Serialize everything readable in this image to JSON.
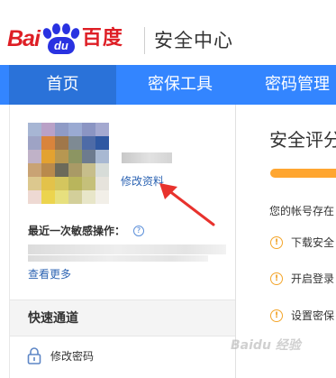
{
  "header": {
    "logo": {
      "text_left": "Bai",
      "paw_text": "du",
      "text_cn": "百度"
    },
    "title": "安全中心"
  },
  "nav": {
    "items": [
      {
        "label": "首页",
        "active": true
      },
      {
        "label": "密保工具",
        "active": false
      },
      {
        "label": "密码管理",
        "active": false
      }
    ]
  },
  "sidebar": {
    "edit_profile_link": "修改资料",
    "recent_sensitive_label": "最近一次敏感操作：",
    "help_icon_glyph": "?",
    "view_more_link": "查看更多",
    "quick_access_title": "快速通道",
    "quick_items": [
      {
        "label": "修改密码",
        "icon": "lock-icon"
      }
    ]
  },
  "main": {
    "title": "安全评分",
    "description": "您的帐号存在",
    "warnings": [
      {
        "text": "下载安全",
        "icon": "warning-circle-icon"
      },
      {
        "text": "开启登录",
        "icon": "warning-circle-icon"
      },
      {
        "text": "设置密保",
        "icon": "warning-circle-icon"
      }
    ],
    "warning_glyph": "!"
  },
  "colors": {
    "brand_red": "#de1e25",
    "brand_blue": "#2932e1",
    "nav_blue": "#3385ff",
    "nav_active": "#2a72d9",
    "link_blue": "#2d64b3",
    "progress_orange": "#ffa630",
    "warning_orange": "#f4a52a",
    "annotation_arrow": "#e8322d"
  },
  "watermark": {
    "text": "Baidu 经验"
  }
}
